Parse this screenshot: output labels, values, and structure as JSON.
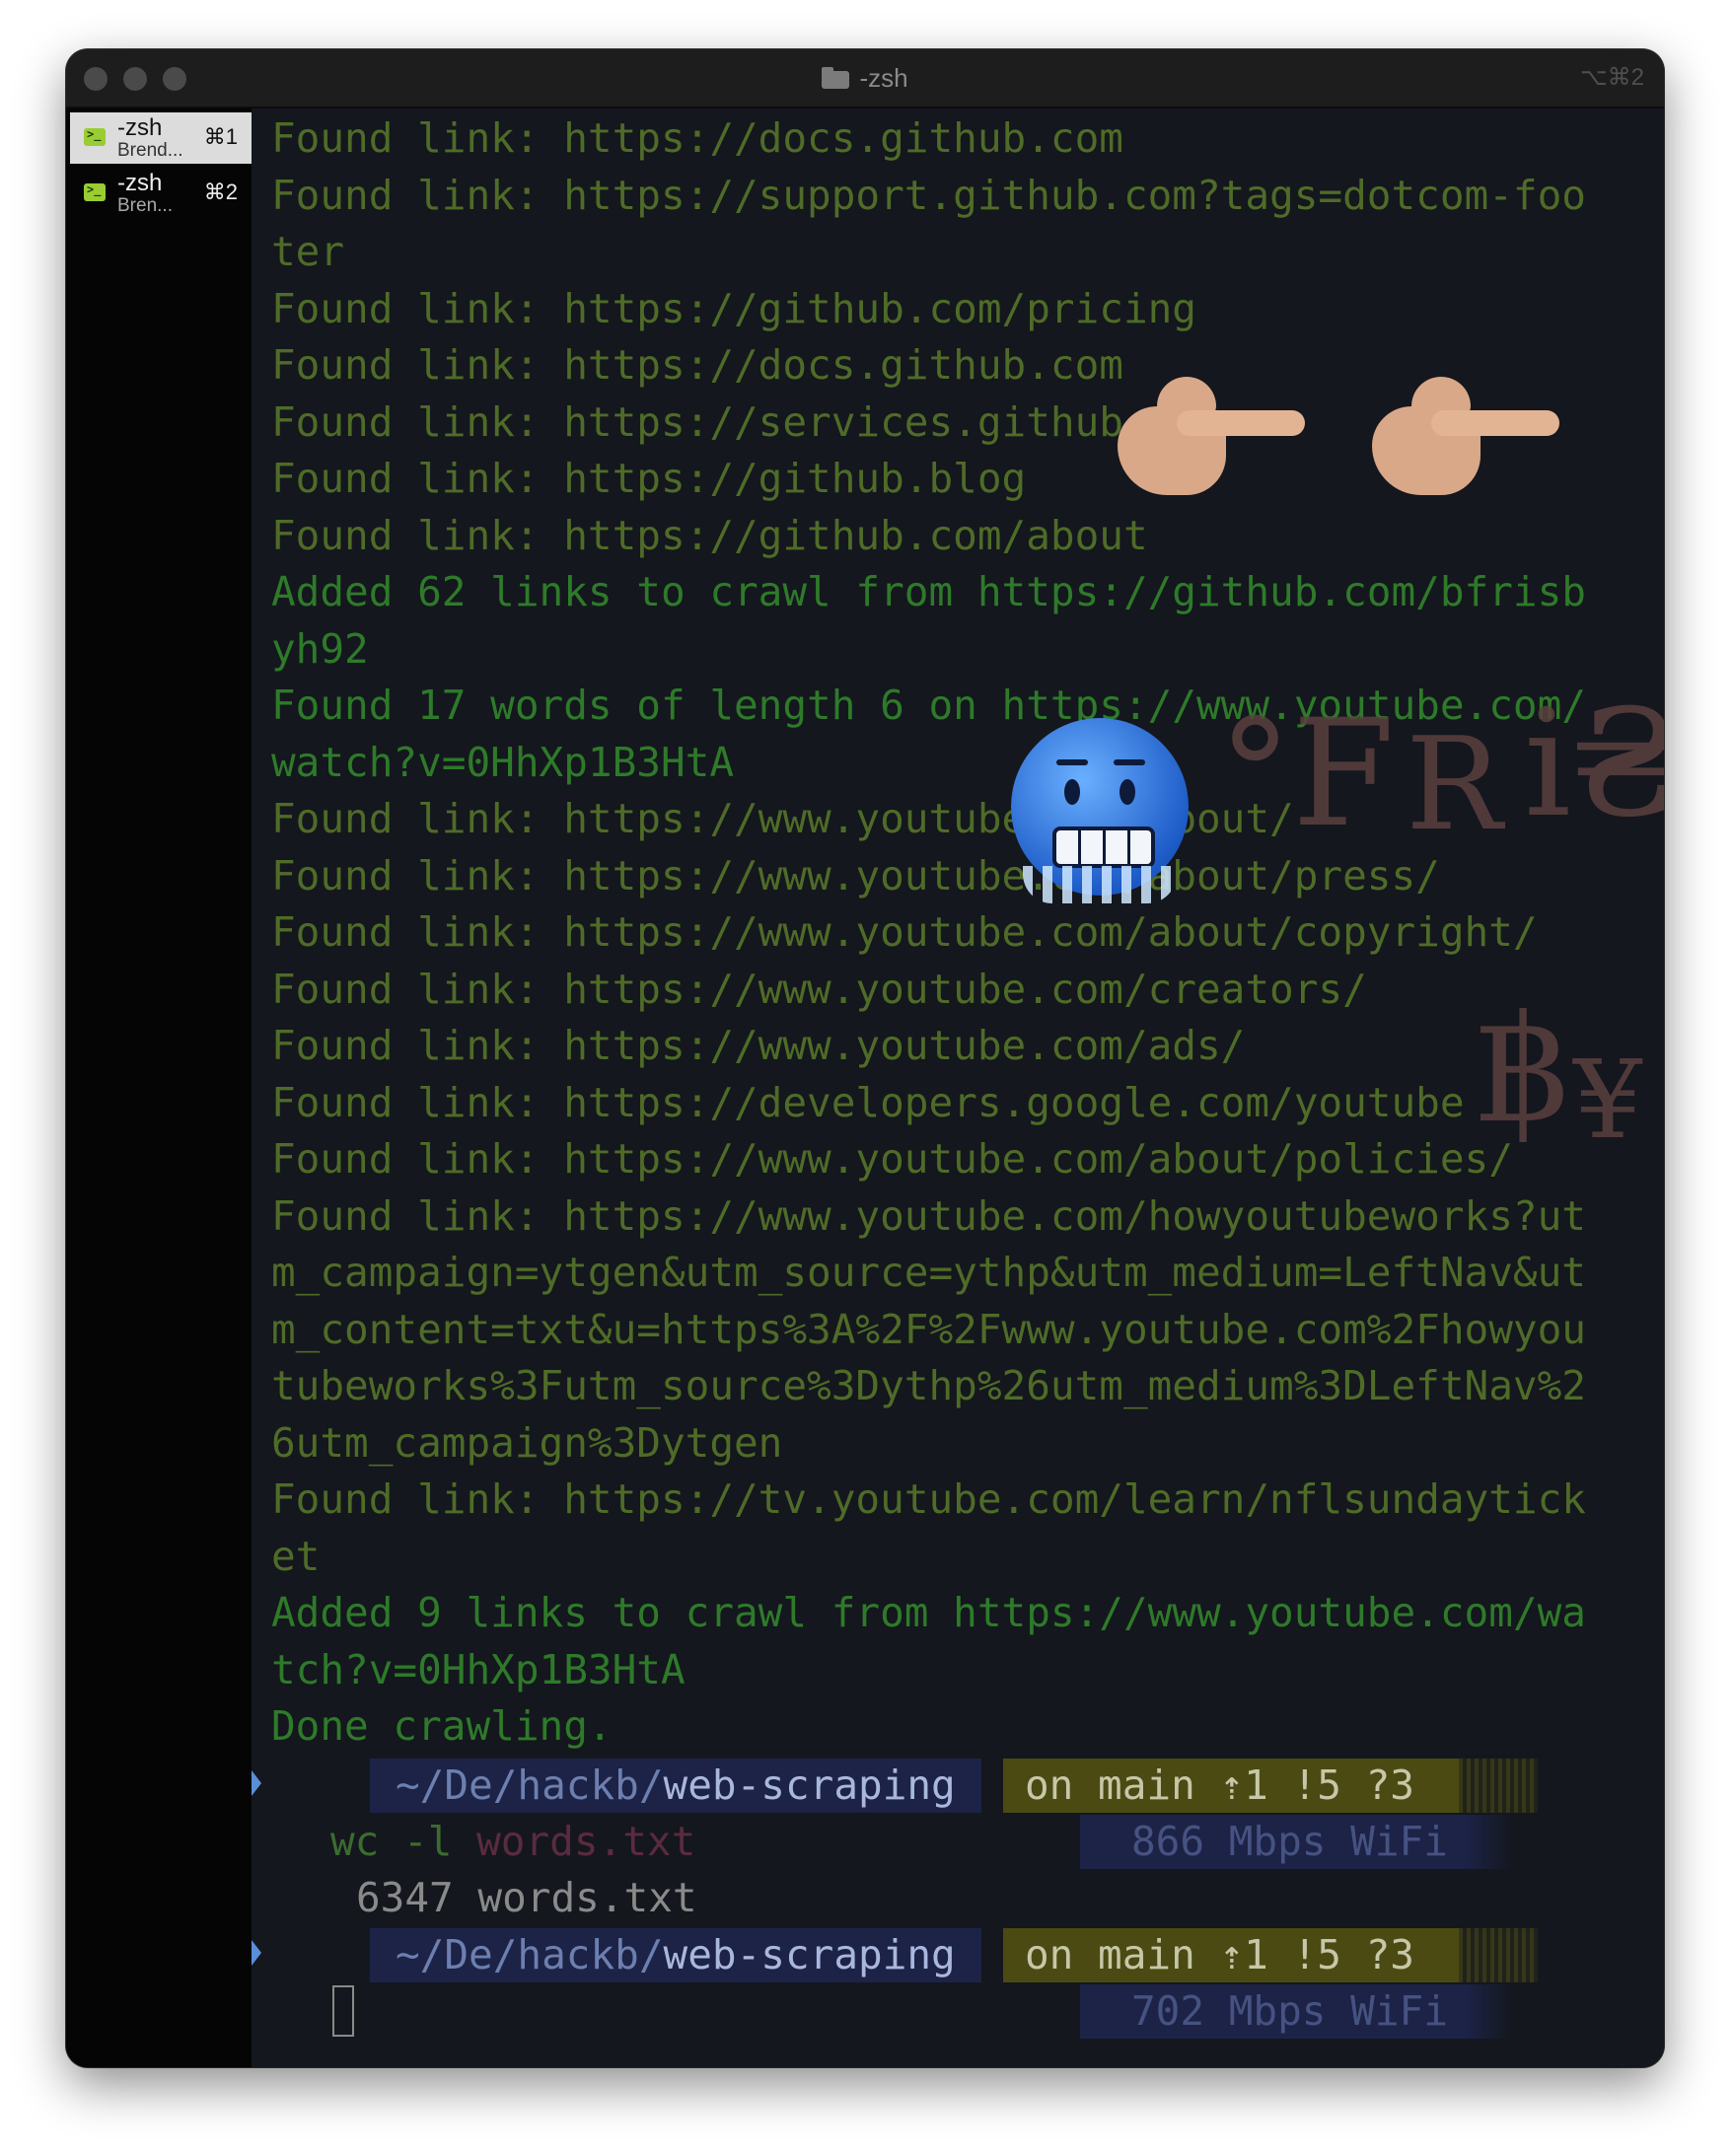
{
  "window": {
    "title": "-zsh",
    "title_shortcut": "⌥⌘2"
  },
  "sidebar": {
    "tabs": [
      {
        "name": "-zsh",
        "subtitle": "Brend...",
        "shortcut": "⌘1",
        "active": true
      },
      {
        "name": "-zsh",
        "subtitle": "Bren...",
        "shortcut": "⌘2",
        "active": false
      }
    ]
  },
  "terminal": {
    "lines": [
      "Found link: https://docs.github.com",
      "Found link: https://support.github.com?tags=dotcom-foo",
      "ter",
      "Found link: https://github.com/pricing",
      "Found link: https://docs.github.com",
      "Found link: https://services.github.com",
      "Found link: https://github.blog",
      "Found link: https://github.com/about",
      "Added 62 links to crawl from https://github.com/bfrisb",
      "yh92",
      "Found 17 words of length 6 on https://www.youtube.com/",
      "watch?v=0HhXp1B3HtA",
      "Found link: https://www.youtube.com/about/",
      "Found link: https://www.youtube.com/about/press/",
      "Found link: https://www.youtube.com/about/copyright/",
      "Found link: https://www.youtube.com/creators/",
      "Found link: https://www.youtube.com/ads/",
      "Found link: https://developers.google.com/youtube",
      "Found link: https://www.youtube.com/about/policies/",
      "Found link: https://www.youtube.com/howyoutubeworks?ut",
      "m_campaign=ytgen&utm_source=ythp&utm_medium=LeftNav&ut",
      "m_content=txt&u=https%3A%2F%2Fwww.youtube.com%2Fhowyou",
      "tubeworks%3Futm_source%3Dythp%26utm_medium%3DLeftNav%2",
      "6utm_campaign%3Dytgen",
      "Found link: https://tv.youtube.com/learn/nflsundaytick",
      "et",
      "Added 9 links to crawl from https://www.youtube.com/wa",
      "tch?v=0HhXp1B3HtA",
      "Done crawling."
    ],
    "prompt1": {
      "path_prefix": "~/De/hackb/",
      "path_dir": "web-scraping",
      "git": "on main ⇡1 !5 ?3",
      "command": "wc -l",
      "command_arg": "words.txt",
      "net": "866 Mbps WiFi",
      "output": "6347 words.txt"
    },
    "prompt2": {
      "path_prefix": "~/De/hackb/",
      "path_dir": "web-scraping",
      "git": "on main ⇡1 !5 ?3",
      "net": "702 Mbps WiFi"
    }
  },
  "overlay_text": {
    "degree_f": "°F",
    "r": "R",
    "i_cedi": "i₴",
    "baht": "฿",
    "yen": "¥"
  },
  "colors": {
    "terminal_bg": "#14171d",
    "text_found": "#4f6b28",
    "text_added": "#2e7a2a",
    "path_bg": "#1c2347",
    "git_bg": "#4a4a12"
  }
}
